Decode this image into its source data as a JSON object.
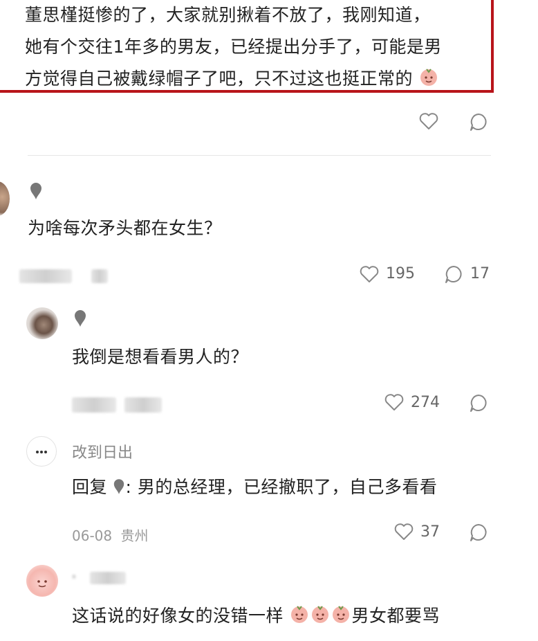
{
  "quote": {
    "lines": [
      "董思槿挺惨的了，大家就别揪着不放了，我刚知道，",
      "她有个交往1年多的男友，已经提出分手了，可能是男",
      "方觉得自己被戴绿帽子了吧，只不过这也挺正常的"
    ]
  },
  "comments": [
    {
      "text": "为啥每次矛头都在女生？",
      "likes": "195",
      "replies": "17"
    },
    {
      "text": "我倒是想看看男人的？",
      "likes": "274"
    },
    {
      "username": "改到日出",
      "reply_prefix": "回复",
      "text": ": 男的总经理，已经撤职了，自己多看看",
      "date": "06-08",
      "location": "贵州",
      "likes": "37"
    },
    {
      "text": "这话说的好像女的没错一样",
      "suffix": "男女都要骂"
    }
  ],
  "colors": {
    "highlight_border": "#b8141a",
    "meta_gray": "#999999",
    "icon_gray": "#888888"
  }
}
